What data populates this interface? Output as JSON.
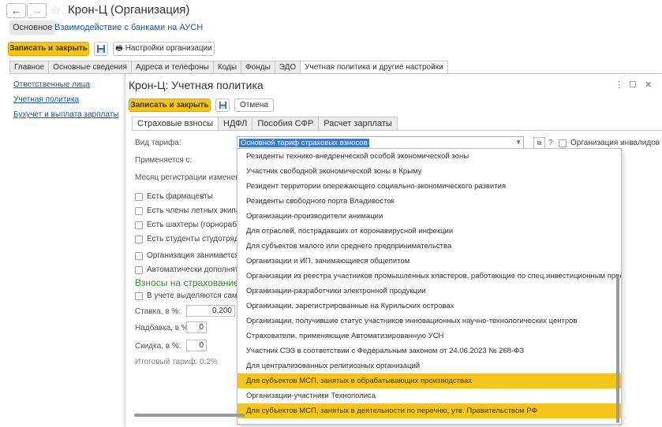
{
  "window": {
    "title": "Крон-Ц (Организация)"
  },
  "top_tabs": {
    "main": "Основное",
    "link": "Взаимодействие с банками на АУСН"
  },
  "toolbar": {
    "save_close": "Записать и закрыть",
    "org_settings": "Настройки организации"
  },
  "sections": [
    "Главное",
    "Основные сведения",
    "Адреса и телефоны",
    "Коды",
    "Фонды",
    "ЭДО",
    "Учетная политика и другие настройки"
  ],
  "sidebar": [
    "Ответственные лица",
    "Учетная политика",
    "Бухучет и выплата зарплаты"
  ],
  "dialog": {
    "title": "Крон-Ц: Учетная политика",
    "save_close": "Записать и закрыть",
    "cancel": "Отмена",
    "tabs": [
      "Страховые взносы",
      "НДФЛ",
      "Пособия СФР",
      "Расчет зарплаты"
    ],
    "tariff_label": "Вид тарифа:",
    "tariff_value": "Основной тариф страховых взносов",
    "question": "?",
    "disabled_org": "Организация инвалидов",
    "applies_from": "Применяется с:",
    "reg_month": "Месяц регистрации изменений:",
    "checks1": [
      "Есть фармацевты",
      "Есть члены летных экипаж",
      "Есть шахтеры (горнорабочи",
      "Есть студенты студотрядов"
    ],
    "checks2": [
      "Организация занимается ра",
      "Автоматически дополнять об"
    ],
    "section_head": "Взносы на страхование от",
    "check3": "В учете выделяются самосто",
    "rate_label": "Ставка, в %:",
    "rate_value": "0,200",
    "extra_label": "Надбавка, в %:",
    "extra_value": "0",
    "discount_label": "Скидка, в %:",
    "discount_value": "0",
    "total_label": "Итоговый тариф: 0,2%"
  },
  "dropdown_items": [
    "Резиденты технико-внедренческой особой экономической зоны",
    "Участник свободной экономической зоны в Крыму",
    "Резидент территории опережающего социально-экономического развития",
    "Резиденты свободного порта Владивосток",
    "Организации-производители анимации",
    "Для отраслей, пострадавших от коронавирусной инфекции",
    "Для субъектов малого или среднего предпринимательства",
    "Организации и ИП, занимающиеся общепитом",
    "Организации из реестра участников промышленных кластеров, работающие по спец.инвестиционным прое...",
    "Организации-разработчики электронной продукции",
    "Организации, зарегистрированные на Курильских островах",
    "Организации, получившие статус участников инновационных научно-технологических центров",
    "Страхователи, применяющие Автоматизированную УСН",
    "Участник СЭЗ в соответствии с Федеральным законом от 24.06.2023 № 268-ФЗ",
    "Для централизованных религиозных организаций",
    "Для субъектов МСП, занятых в обрабатывающих производствах",
    "Организации-участники Технополиса",
    "Для субъектов МСП, занятых в деятельности по перечню, утв. Правительством РФ"
  ],
  "highlighted": [
    15,
    17
  ],
  "colors": {
    "accent": "#f5c619",
    "link": "#1a56b0",
    "green_head": "#338a33"
  }
}
